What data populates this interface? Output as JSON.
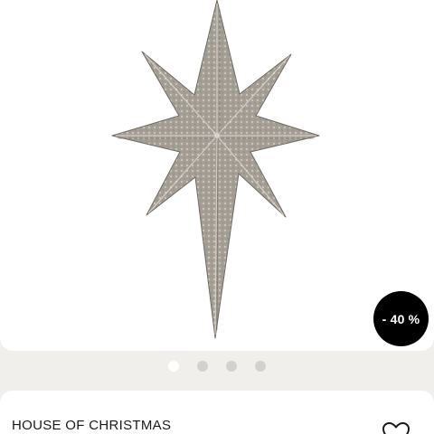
{
  "product": {
    "brand": "HOUSE OF CHRISTMAS",
    "discount_badge": "- 40 %"
  },
  "carousel": {
    "total_slides": 4,
    "active_slide": 1
  },
  "colors": {
    "background": "#f1efeb",
    "card": "#ffffff",
    "badge": "#000000",
    "badge_text": "#ffffff",
    "dot_inactive": "#d3d1cd",
    "dot_active": "#ffffff",
    "star": "#a39d94"
  },
  "icons": {
    "wishlist": "heart-outline-icon"
  }
}
